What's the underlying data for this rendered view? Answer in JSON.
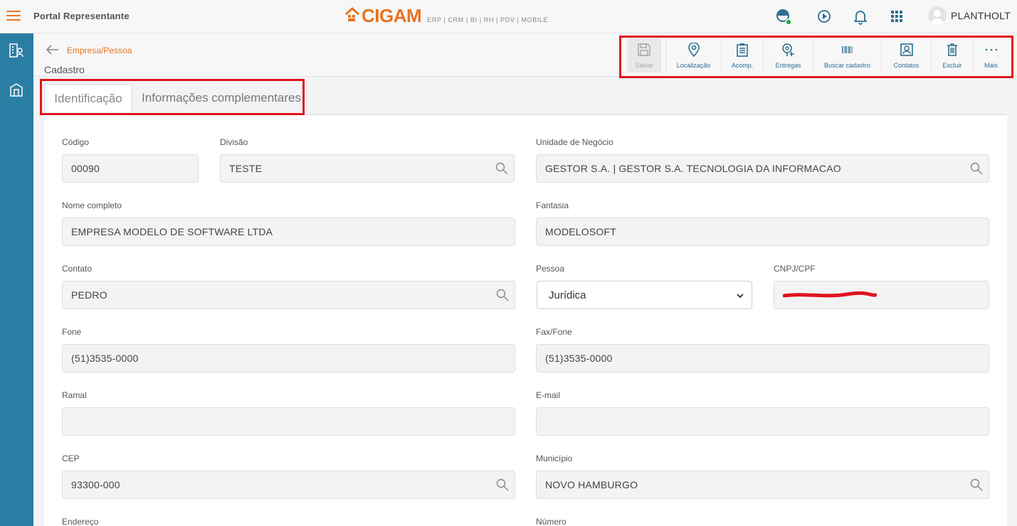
{
  "app": {
    "portal_title": "Portal Representante",
    "logo_text": "CIGAM",
    "logo_tagline": "ERP | CRM | BI | RH | PDV | MOBILE",
    "user_name": "PLANTHOLT",
    "accent_color": "#e8731f",
    "sidebar_color": "#2b7ea3"
  },
  "header": {
    "breadcrumb": "Empresa/Pessoa",
    "subtitle": "Cadastro"
  },
  "toolbar": {
    "items": [
      {
        "label": "Salvar",
        "icon": "save-icon",
        "enabled": false
      },
      {
        "label": "Localização",
        "icon": "location-pin-icon",
        "enabled": true
      },
      {
        "label": "Acomp.",
        "icon": "clipboard-icon",
        "enabled": true
      },
      {
        "label": "Entregas",
        "icon": "delivery-pin-icon",
        "enabled": true
      },
      {
        "label": "Buscar cadastro",
        "icon": "barcode-icon",
        "enabled": true
      },
      {
        "label": "Contatos",
        "icon": "contact-card-icon",
        "enabled": true
      },
      {
        "label": "Excluir",
        "icon": "trash-icon",
        "enabled": true
      },
      {
        "label": "Mais",
        "icon": "more-dots-icon",
        "enabled": true
      }
    ]
  },
  "tabs": [
    {
      "label": "Identificação",
      "active": true
    },
    {
      "label": "Informações complementares",
      "active": false
    }
  ],
  "form": {
    "codigo": {
      "label": "Código",
      "value": "00090"
    },
    "divisao": {
      "label": "Divisão",
      "value": "TESTE"
    },
    "unidade": {
      "label": "Unidade de Negócio",
      "value": "GESTOR S.A. | GESTOR S.A. TECNOLOGIA DA INFORMACAO"
    },
    "nome": {
      "label": "Nome completo",
      "value": "EMPRESA MODELO DE SOFTWARE LTDA"
    },
    "fantasia": {
      "label": "Fantasia",
      "value": "MODELOSOFT"
    },
    "contato": {
      "label": "Contato",
      "value": "PEDRO"
    },
    "pessoa": {
      "label": "Pessoa",
      "value": "Jurídica"
    },
    "cnpj": {
      "label": "CNPJ/CPF",
      "value": ""
    },
    "fone": {
      "label": "Fone",
      "value": "(51)3535-0000"
    },
    "fax": {
      "label": "Fax/Fone",
      "value": "(51)3535-0000"
    },
    "ramal": {
      "label": "Ramal",
      "value": ""
    },
    "email": {
      "label": "E-mail",
      "value": ""
    },
    "cep": {
      "label": "CEP",
      "value": "93300-000"
    },
    "municipio": {
      "label": "Município",
      "value": "NOVO HAMBURGO"
    },
    "endereco": {
      "label": "Endereço"
    },
    "numero": {
      "label": "Número"
    }
  }
}
